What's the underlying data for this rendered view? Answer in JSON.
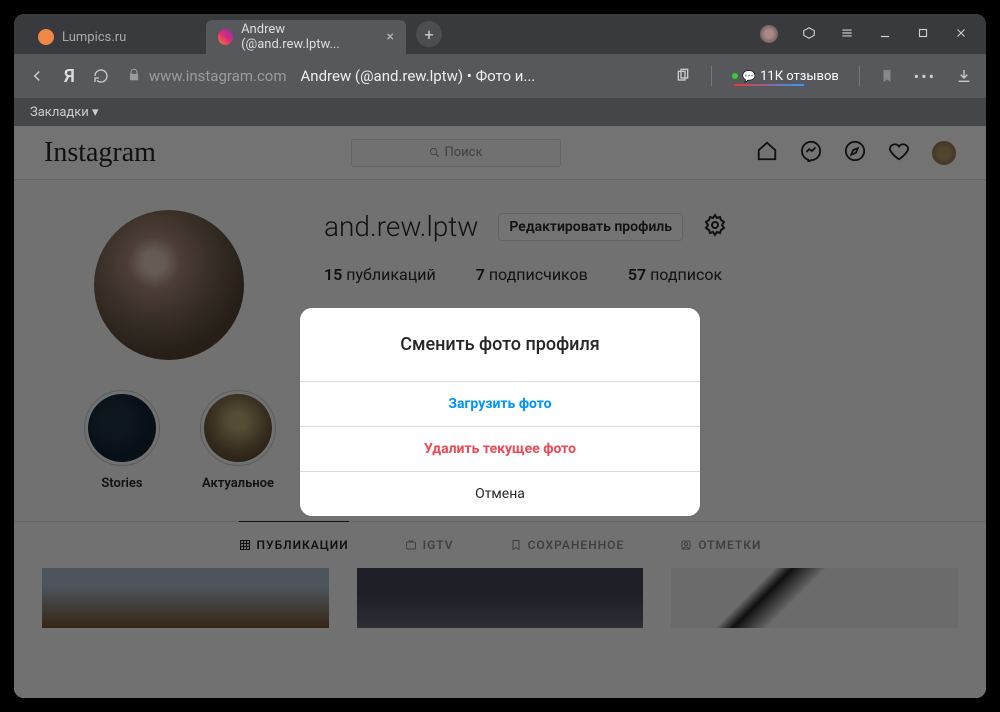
{
  "browser": {
    "tabs": [
      {
        "title": "Lumpics.ru"
      },
      {
        "title": "Andrew (@and.rew.lptw..."
      }
    ],
    "url_domain": "www.instagram.com",
    "page_title": "Andrew (@and.rew.lptw) • Фото и...",
    "reviews": "11К отзывов",
    "bookmarks_label": "Закладки ▾"
  },
  "instagram": {
    "logo": "Instagram",
    "search_placeholder": "Поиск",
    "username": "and.rew.lptw",
    "edit_profile": "Редактировать профиль",
    "stats": {
      "posts_count": "15",
      "posts_label": "публикаций",
      "followers_count": "7",
      "followers_label": "подписчиков",
      "following_count": "57",
      "following_label": "подписок"
    },
    "highlights": [
      {
        "label": "Stories"
      },
      {
        "label": "Актуальное"
      }
    ],
    "tabs": {
      "posts": "ПУБЛИКАЦИИ",
      "igtv": "IGTV",
      "saved": "СОХРАНЕННОЕ",
      "tagged": "ОТМЕТКИ"
    }
  },
  "modal": {
    "title": "Сменить фото профиля",
    "upload": "Загрузить фото",
    "remove": "Удалить текущее фото",
    "cancel": "Отмена"
  }
}
